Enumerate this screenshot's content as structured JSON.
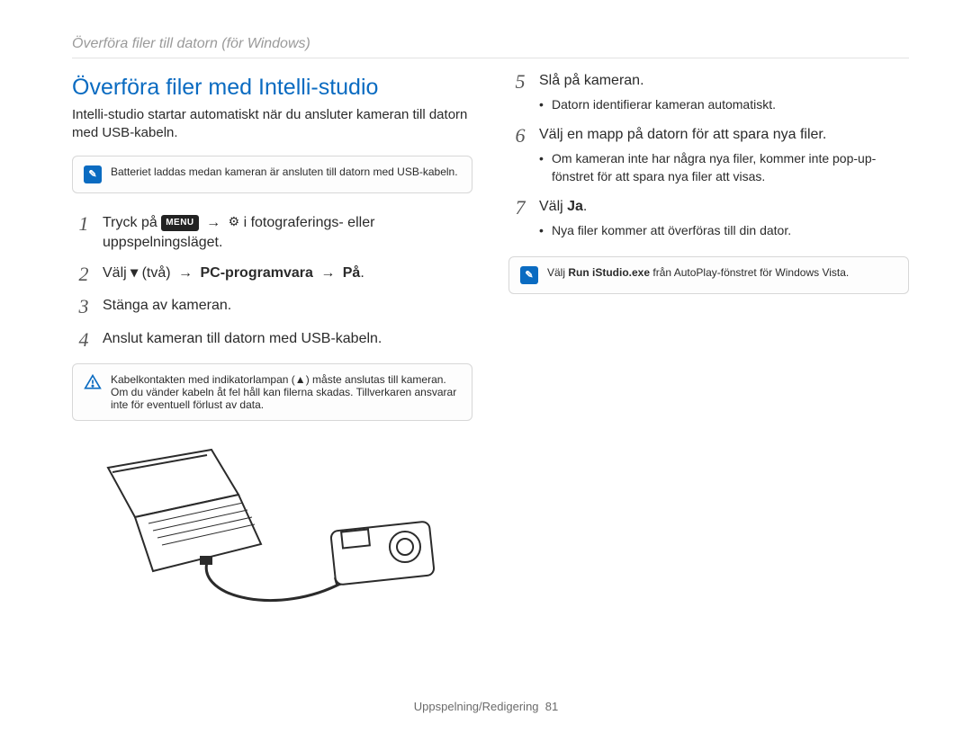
{
  "running_head": "Överföra filer till datorn (för Windows)",
  "heading": "Överföra filer med Intelli-studio",
  "lead": "Intelli-studio startar automatiskt när du ansluter kameran till datorn med USB-kabeln.",
  "note1": "Batteriet laddas medan kameran är ansluten till datorn med USB-kabeln.",
  "left_steps": {
    "s1_before": "Tryck på ",
    "s1_after_menu": " ",
    "s1_arrow1": "→",
    "s1_after_gear": " i fotograferings- eller uppspelningsläget.",
    "s2_before": "Välj ",
    "s2_down": "▾",
    "s2_parens": " (två) ",
    "s2_arrow1": "→",
    "s2_bold1": " PC-programvara ",
    "s2_arrow2": "→",
    "s2_bold2": " På",
    "s2_end": ".",
    "s3": "Stänga av kameran.",
    "s4": "Anslut kameran till datorn med USB-kabeln."
  },
  "warn_lines": {
    "l1_before": "Kabelkontakten med indikatorlampan (",
    "l1_tri": "▲",
    "l1_after": ") måste anslutas till kameran. Om du vänder kabeln åt fel håll kan filerna skadas. Tillverkaren ansvarar inte för eventuell förlust av data."
  },
  "right_steps": {
    "s5": "Slå på kameran.",
    "s5_b1": "Datorn identifierar kameran automatiskt.",
    "s6": "Välj en mapp på datorn för att spara nya filer.",
    "s6_b1": "Om kameran inte har några nya filer, kommer inte pop-up-fönstret för att spara nya filer att visas.",
    "s7_before": "Välj ",
    "s7_bold": "Ja",
    "s7_after": ".",
    "s7_b1": "Nya filer kommer att överföras till din dator."
  },
  "note2_before": "Välj ",
  "note2_bold": "Run iStudio.exe",
  "note2_after": " från AutoPlay-fönstret för Windows Vista.",
  "menu_label": "MENU",
  "footer_label": "Uppspelning/Redigering",
  "footer_page": "81"
}
